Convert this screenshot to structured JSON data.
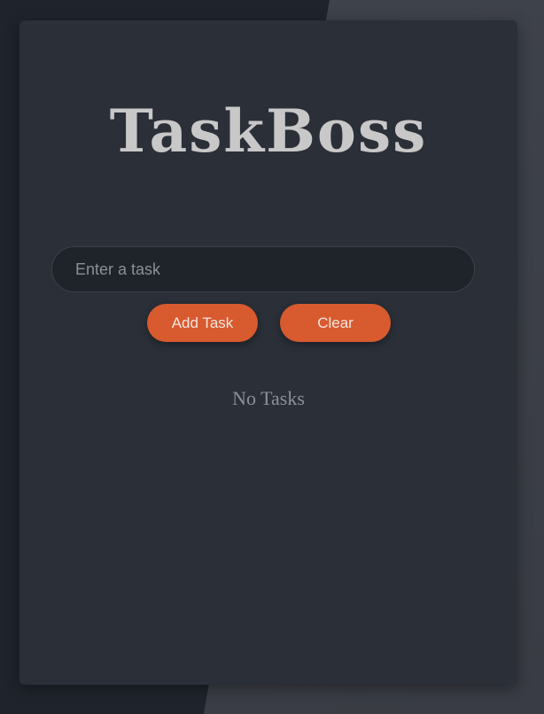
{
  "app": {
    "title": "TaskBoss"
  },
  "form": {
    "input_value": "",
    "input_placeholder": "Enter a task",
    "add_label": "Add Task",
    "clear_label": "Clear"
  },
  "tasks": {
    "items": [],
    "empty_message": "No Tasks"
  },
  "colors": {
    "accent": "#d85a2f",
    "card": "#2a2f38",
    "title": "#c8c8c8"
  }
}
